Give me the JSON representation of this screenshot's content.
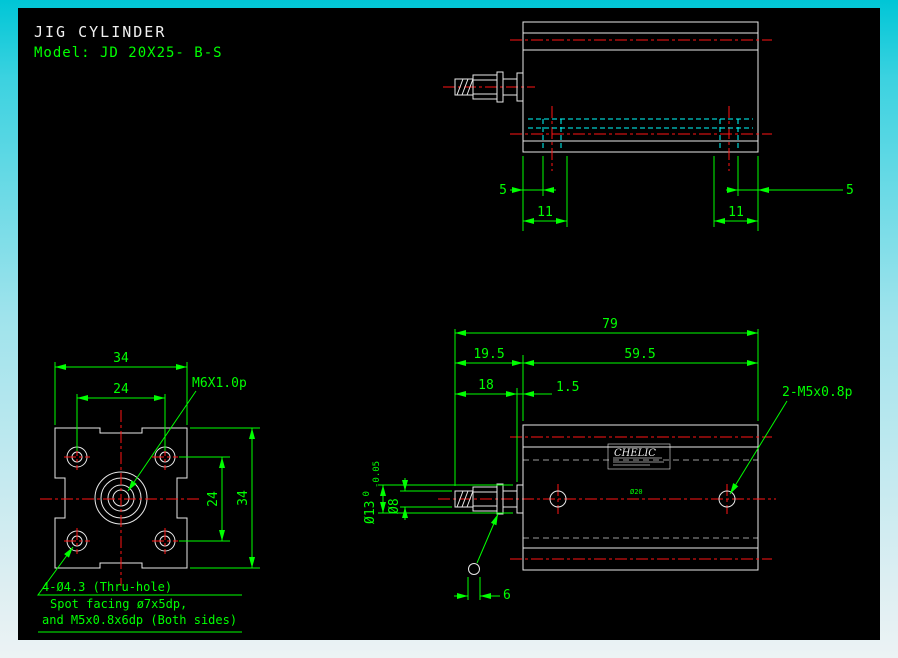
{
  "header": {
    "title": "JIG CYLINDER",
    "model": "Model: JD 20X25- B-S"
  },
  "palette": {
    "background": "#000000",
    "frame_top": "#00c6d6",
    "frame_bottom": "#ecf3f4",
    "outline_white": "#e8e8e8",
    "dimension_green": "#00ff00",
    "centerline_red": "#ff1414",
    "hidden_cyan": "#00ffff"
  },
  "top_view": {
    "dims": {
      "left_5": "5",
      "left_11": "11",
      "right_11": "11",
      "right_5": "5"
    }
  },
  "front_view": {
    "dims": {
      "width_34": "34",
      "width_24": "24",
      "height_24": "24",
      "height_34": "34"
    },
    "labels": {
      "thread": "M6X1.0p",
      "thru_hole": "4-Ø4.3 (Thru-hole)",
      "note1": "Spot facing ø7x5dp,",
      "note2": "and M5x0.8x6dp (Both sides)"
    }
  },
  "side_view": {
    "dims": {
      "overall_79": "79",
      "rod_19_5": "19.5",
      "body_59_5": "59.5",
      "rod_18": "18",
      "boss_1_5": "1.5",
      "dia_13": "Ø13",
      "tol_upper": "0",
      "tol_lower": "-0.05",
      "dia_8": "Ø8",
      "width_6": "6"
    },
    "labels": {
      "mount_thread": "2-M5x0.8p",
      "bore": "Ø20",
      "brand": "CHELIC"
    }
  }
}
